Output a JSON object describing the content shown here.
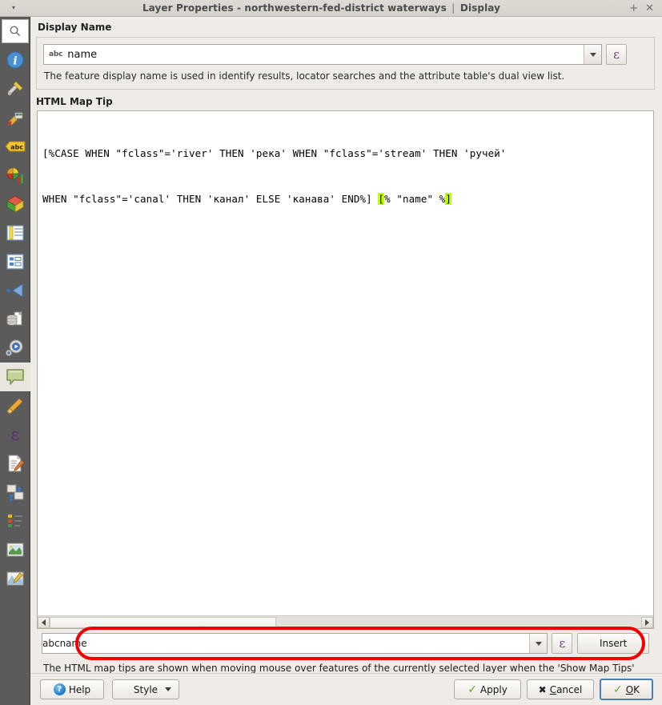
{
  "window": {
    "title_main": "Layer Properties - northwestern-fed-district waterways",
    "title_separator": "|",
    "title_section": "Display",
    "menu_caret": "▾",
    "btn_maximize": "+",
    "btn_close": "✕"
  },
  "sidebar": {
    "search_placeholder": "",
    "items": [
      {
        "name": "information",
        "icon": "info-icon"
      },
      {
        "name": "source",
        "icon": "wrench-screwdriver-icon"
      },
      {
        "name": "symbology",
        "icon": "paintbrush-palette-icon"
      },
      {
        "name": "labels",
        "icon": "abc-label-icon"
      },
      {
        "name": "diagrams",
        "icon": "pie-bar-chart-icon"
      },
      {
        "name": "3d-view",
        "icon": "cube-3d-icon"
      },
      {
        "name": "fields",
        "icon": "table-fields-icon"
      },
      {
        "name": "attributes-form",
        "icon": "form-layout-icon"
      },
      {
        "name": "joins",
        "icon": "join-arrow-icon"
      },
      {
        "name": "auxiliary-storage",
        "icon": "database-file-icon"
      },
      {
        "name": "actions",
        "icon": "gear-play-icon"
      },
      {
        "name": "display",
        "icon": "speech-bubble-icon",
        "selected": true
      },
      {
        "name": "rendering",
        "icon": "broom-icon"
      },
      {
        "name": "variables",
        "icon": "epsilon-icon"
      },
      {
        "name": "metadata",
        "icon": "document-pencil-icon"
      },
      {
        "name": "dependencies",
        "icon": "sync-arrows-icon"
      },
      {
        "name": "legend",
        "icon": "legend-swatches-icon"
      },
      {
        "name": "qgis-server",
        "icon": "picture-globe-icon"
      },
      {
        "name": "digitizing",
        "icon": "map-pencil-icon"
      }
    ]
  },
  "display_name": {
    "group_label": "Display Name",
    "field_type_badge": "abc",
    "value": "name",
    "dropdown_icon": "chevron-down-icon",
    "expression_button": "ε",
    "hint": "The feature display name is used in identify results, locator searches and the attribute table's dual view list."
  },
  "map_tip": {
    "group_label": "HTML Map Tip",
    "code_line_1": "[%CASE WHEN \"fclass\"='river' THEN 'река' WHEN \"fclass\"='stream' THEN 'ручей'",
    "code_line_2_pre": "WHEN \"fclass\"='canal' THEN 'канал' ELSE 'канава' END%] ",
    "code_line_2_br_open": "[",
    "code_line_2_expr": "% \"name\" %",
    "code_line_2_br_close": "]",
    "highlight_color": "#bfff00",
    "scroll_left_arrow": "◀",
    "scroll_right_arrow": "▶"
  },
  "insert_row": {
    "field_type_badge": "abc",
    "value": "name",
    "dropdown_icon": "chevron-down-icon",
    "expression_button": "ε",
    "insert_label": "Insert",
    "annotation_color": "#f20000"
  },
  "bottom_description": "The HTML map tips are shown when moving mouse over features of the currently selected layer when the 'Show Map Tips' action is toggled on. If no HTML code is set, the feature display name is used.",
  "buttons": {
    "help": "Help",
    "style": "Style",
    "style_caret": "▾",
    "apply": "Apply",
    "cancel": "Cancel",
    "cancel_prefix": "C",
    "cancel_rest": "ancel",
    "ok": "OK",
    "ok_prefix": "O",
    "ok_rest": "K",
    "help_glyph": "?",
    "check_glyph": "✓",
    "x_glyph": "✖"
  }
}
